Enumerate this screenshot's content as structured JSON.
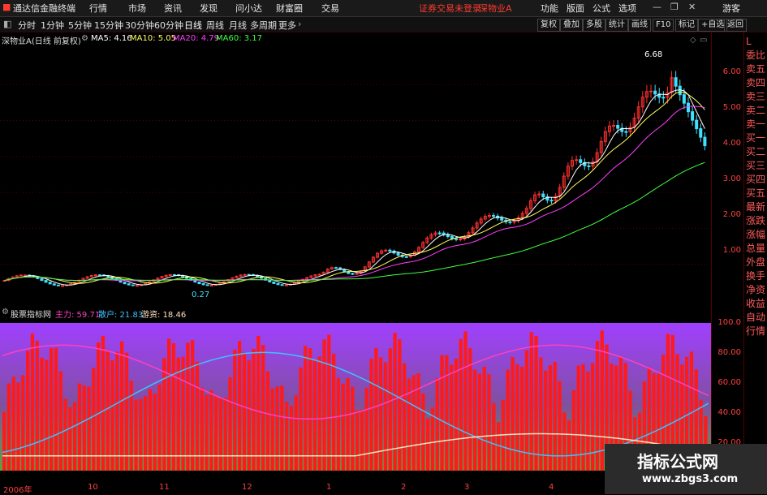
{
  "menubar": {
    "app_title": "通达信金融终端",
    "menus": [
      "行情",
      "市场",
      "资讯",
      "发现",
      "问小达",
      "财富圈",
      "交易"
    ],
    "broker_notice": "证券交易未登录",
    "stock_name": "深物业A",
    "right_items": [
      "功能",
      "版面",
      "公式",
      "选项"
    ],
    "user": "游客"
  },
  "toolbar": {
    "periods": [
      "分时",
      "1分钟",
      "5分钟",
      "15分钟",
      "30分钟",
      "60分钟",
      "日线",
      "周线",
      "月线",
      "多周期",
      "更多"
    ],
    "active_period": "日线",
    "right_buttons": [
      "复权",
      "叠加",
      "多股",
      "统计",
      "画线",
      "F10",
      "标记",
      "+自选",
      "返回"
    ]
  },
  "price_panel": {
    "title": "深物业A(日线 前复权)",
    "ma5": "MA5: 4.16",
    "ma10": "MA10: 5.05",
    "ma20": "MA20: 4.79",
    "ma60": "MA60: 3.17",
    "high_label": "6.68",
    "low_label": "0.27",
    "y_ticks": [
      "6.00",
      "5.00",
      "4.00",
      "3.00",
      "2.00",
      "1.00"
    ]
  },
  "indicator_panel": {
    "title": "股票指标网",
    "zhuli": "主力: 59.71",
    "sanhu": "散户: 21.83",
    "youzi": "游资: 18.46",
    "y_ticks": [
      "100.0",
      "80.00",
      "60.00",
      "40.00",
      "20.00"
    ]
  },
  "right_column": {
    "items": [
      "L",
      "委比",
      "卖五",
      "卖四",
      "卖三",
      "卖二",
      "卖一",
      "买一",
      "买二",
      "买三",
      "买四",
      "买五",
      "最新",
      "涨跌",
      "涨幅",
      "总量",
      "外盘",
      "换手",
      "净资",
      "收益",
      "自动",
      "行情"
    ]
  },
  "date_axis": [
    "2006年",
    "10",
    "11",
    "12",
    "1",
    "2",
    "3",
    "4"
  ],
  "watermark": {
    "line1": "指标公式网",
    "line2": "www.zbgs3.com"
  },
  "colors": {
    "up": "#ff3030",
    "down": "#40e0ff",
    "ma5": "#ffffff",
    "ma10": "#ffff60",
    "ma20": "#ff40ff",
    "ma60": "#40ff40",
    "zhuli": "#ff40c0",
    "sanhu": "#40c0ff",
    "youzi": "#ffe0c0"
  }
}
